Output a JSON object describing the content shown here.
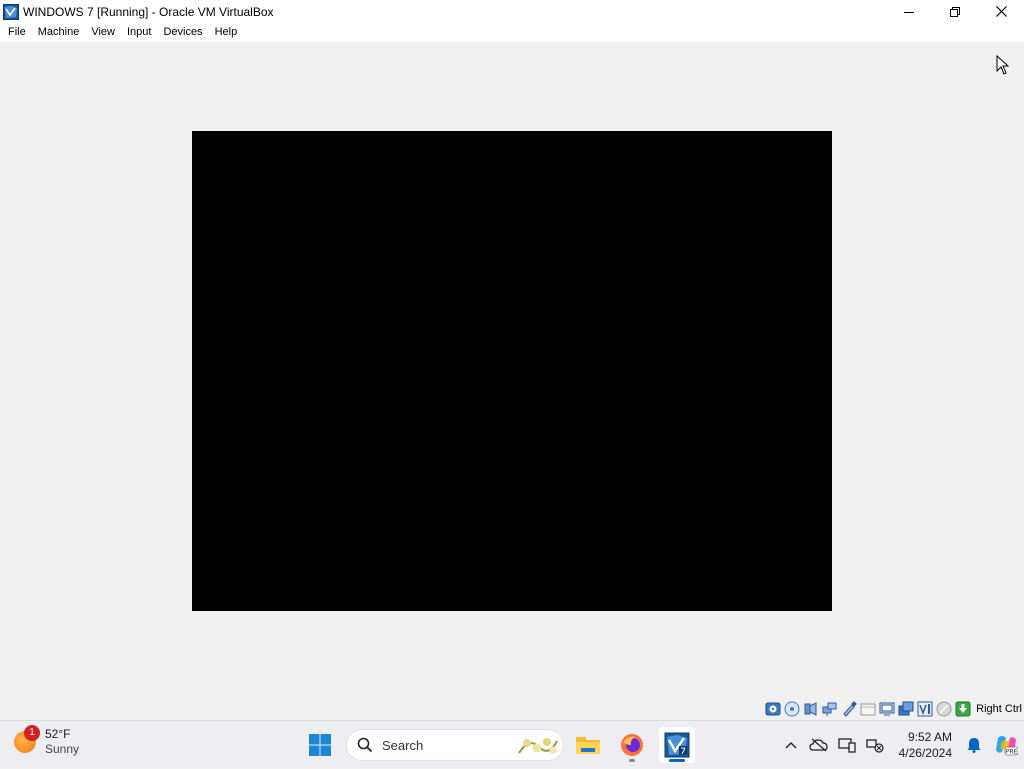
{
  "window": {
    "title": "WINDOWS 7 [Running] - Oracle VM VirtualBox",
    "icon": "virtualbox-icon",
    "controls": [
      "minimize-icon",
      "restore-icon",
      "close-icon"
    ]
  },
  "menubar": {
    "items": [
      {
        "label": "File"
      },
      {
        "label": "Machine"
      },
      {
        "label": "View"
      },
      {
        "label": "Input"
      },
      {
        "label": "Devices"
      },
      {
        "label": "Help"
      }
    ]
  },
  "vm": {
    "screen_color": "#000000",
    "background_color": "#f0f0f0"
  },
  "statusbar": {
    "icons": [
      "hard-disk-icon",
      "optical-drive-icon",
      "audio-icon",
      "network-icon",
      "usb-icon",
      "shared-folders-icon",
      "display-icon",
      "video-capture-icon",
      "cpu-virtualization-icon",
      "mouse-integration-icon",
      "keyboard-capture-icon"
    ],
    "host_key": "Right Ctrl"
  },
  "taskbar": {
    "weather": {
      "temp": "52°F",
      "condition": "Sunny",
      "badge": "1"
    },
    "search": {
      "placeholder": "Search"
    },
    "apps": [
      {
        "name": "start-button",
        "icon": "windows-logo-icon"
      },
      {
        "name": "file-explorer",
        "icon": "folder-icon"
      },
      {
        "name": "firefox",
        "icon": "firefox-icon"
      },
      {
        "name": "virtualbox",
        "icon": "virtualbox-icon"
      }
    ],
    "tray": {
      "icons": [
        "chevron-up-icon",
        "onedrive-offline-icon",
        "display-devices-icon",
        "network-disconnected-icon",
        "notification-bell-icon",
        "copilot-icon"
      ],
      "time": "9:52 AM",
      "date": "4/26/2024"
    },
    "accent": "#0067c0"
  }
}
